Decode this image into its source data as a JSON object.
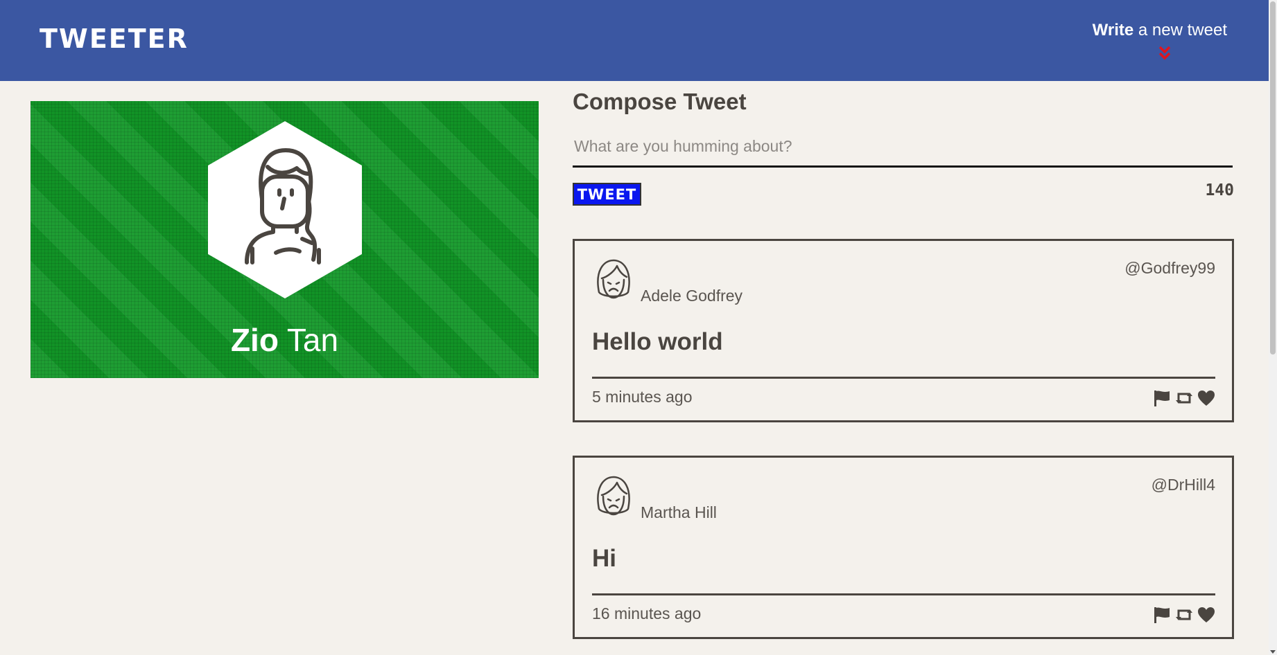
{
  "header": {
    "logo": "TWEETER",
    "write_bold": "Write",
    "write_rest": " a new tweet"
  },
  "profile": {
    "first_name": "Zio",
    "last_name": " Tan",
    "background_color": "#129828"
  },
  "compose": {
    "title": "Compose Tweet",
    "placeholder": "What are you humming about?",
    "button_label": "TWEET",
    "counter": "140",
    "button_color": "#0a17ef"
  },
  "tweets": [
    {
      "author": "Adele Godfrey",
      "handle": "@Godfrey99",
      "content": "Hello world",
      "time": "5 minutes ago"
    },
    {
      "author": "Martha Hill",
      "handle": "@DrHill4",
      "content": "Hi",
      "time": "16 minutes ago"
    }
  ],
  "icons": [
    "chevron-double-down-icon",
    "flag-icon",
    "retweet-icon",
    "heart-icon"
  ],
  "colors": {
    "header": "#3b57a2",
    "accent_chevron": "#e0141e",
    "page_bg": "#f4f1ec"
  }
}
